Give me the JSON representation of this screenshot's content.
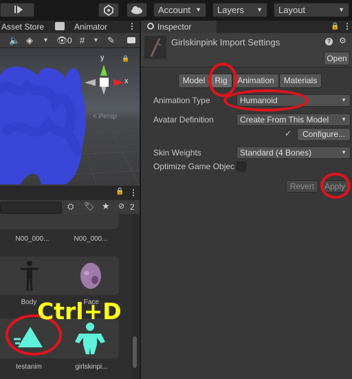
{
  "toolbar": {
    "account_label": "Account",
    "layers_label": "Layers",
    "layout_label": "Layout"
  },
  "left_tabs": {
    "asset_store": "Asset Store",
    "animator": "Animator"
  },
  "scene": {
    "gizmo_y": "y",
    "gizmo_x": "x",
    "persp_label": "< Persp",
    "visibility_count": "0"
  },
  "project": {
    "hidden_count": "2"
  },
  "assets": {
    "row1_left": "N00_000...",
    "row1_right": "N00_000...",
    "body_label": "Body",
    "face_label": "Face",
    "testanim_label": "testanim",
    "girlskin_label": "girlskinpi..."
  },
  "overlay_text": "Ctrl+D",
  "inspector": {
    "tab_label": "Inspector",
    "title": "Girlskinpink Import Settings",
    "open_button": "Open",
    "tabs": [
      "Model",
      "Rig",
      "Animation",
      "Materials"
    ],
    "animation_type_label": "Animation Type",
    "animation_type_value": "Humanoid",
    "avatar_definition_label": "Avatar Definition",
    "avatar_definition_value": "Create From This Model",
    "configure_button": "Configure...",
    "skin_weights_label": "Skin Weights",
    "skin_weights_value": "Standard (4 Bones)",
    "optimize_label": "Optimize Game Objec",
    "revert_button": "Revert",
    "apply_button": "Apply"
  },
  "colors": {
    "annotation_red": "#e0141c",
    "overlay_yellow": "#ffff1a",
    "scribble_blue": "#3a46d8",
    "icon_cyan": "#5ef2da"
  }
}
